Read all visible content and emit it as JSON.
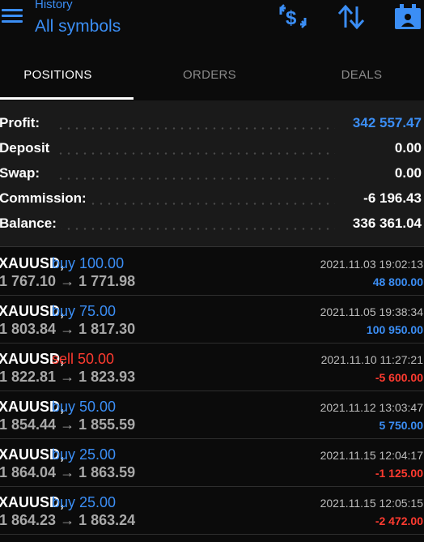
{
  "header": {
    "subtitle": "History",
    "title": "All symbols",
    "icons": {
      "menu": "menu-icon",
      "currency": "currency-exchange-icon",
      "sort": "sort-icon",
      "calendar": "calendar-icon"
    },
    "accent": "#3b8ef5"
  },
  "tabs": [
    {
      "label": "POSITIONS",
      "active": true
    },
    {
      "label": "ORDERS",
      "active": false
    },
    {
      "label": "DEALS",
      "active": false
    }
  ],
  "summary": {
    "profit": {
      "label": "Profit:",
      "value": "342 557.47"
    },
    "deposit": {
      "label": "Deposit",
      "value": "0.00"
    },
    "swap": {
      "label": "Swap:",
      "value": "0.00"
    },
    "commission": {
      "label": "Commission:",
      "value": "-6 196.43"
    },
    "balance": {
      "label": "Balance:",
      "value": "336 361.04"
    }
  },
  "positions": [
    {
      "symbol": "XAUUSD,",
      "side": "buy 100.00",
      "prices": "1 767.10 → 1 771.98",
      "time": "2021.11.03 19:02:13",
      "profit": "48 800.00",
      "type": "buy",
      "sign": "pos"
    },
    {
      "symbol": "XAUUSD,",
      "side": "buy 75.00",
      "prices": "1 803.84 → 1 817.30",
      "time": "2021.11.05 19:38:34",
      "profit": "100 950.00",
      "type": "buy",
      "sign": "pos"
    },
    {
      "symbol": "XAUUSD,",
      "side": "sell 50.00",
      "prices": "1 822.81 → 1 823.93",
      "time": "2021.11.10 11:27:21",
      "profit": "-5 600.00",
      "type": "sell",
      "sign": "neg"
    },
    {
      "symbol": "XAUUSD,",
      "side": "buy 50.00",
      "prices": "1 854.44 → 1 855.59",
      "time": "2021.11.12 13:03:47",
      "profit": "5 750.00",
      "type": "buy",
      "sign": "pos"
    },
    {
      "symbol": "XAUUSD,",
      "side": "buy 25.00",
      "prices": "1 864.04 → 1 863.59",
      "time": "2021.11.15 12:04:17",
      "profit": "-1 125.00",
      "type": "buy",
      "sign": "neg"
    },
    {
      "symbol": "XAUUSD,",
      "side": "buy 25.00",
      "prices": "1 864.23 → 1 863.24",
      "time": "2021.11.15 12:05:15",
      "profit": "-2 472.00",
      "type": "buy",
      "sign": "neg"
    }
  ]
}
